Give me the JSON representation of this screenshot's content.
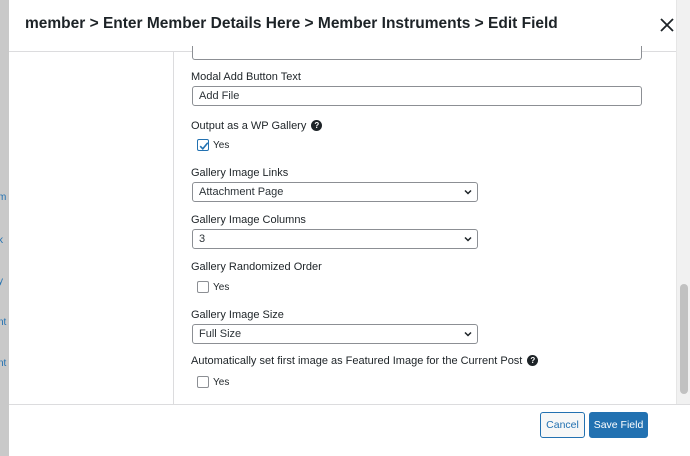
{
  "background": {
    "links": [
      "m",
      "k",
      "y",
      "nt",
      "nt"
    ]
  },
  "modal": {
    "title": "member > Enter Member Details Here > Member Instruments > Edit Field",
    "close_icon": "close-icon"
  },
  "fields": {
    "modal_add_button_text": {
      "label": "Modal Add Button Text",
      "value": "Add File"
    },
    "output_wp_gallery": {
      "label": "Output as a WP Gallery",
      "option": "Yes",
      "checked": true
    },
    "gallery_image_links": {
      "label": "Gallery Image Links",
      "selected": "Attachment Page"
    },
    "gallery_image_columns": {
      "label": "Gallery Image Columns",
      "selected": "3"
    },
    "gallery_randomized_order": {
      "label": "Gallery Randomized Order",
      "option": "Yes",
      "checked": false
    },
    "gallery_image_size": {
      "label": "Gallery Image Size",
      "selected": "Full Size"
    },
    "featured_image": {
      "label": "Automatically set first image as Featured Image for the Current Post",
      "option": "Yes",
      "checked": false
    }
  },
  "footer": {
    "cancel_label": "Cancel",
    "save_label": "Save Field"
  },
  "colors": {
    "accent": "#2271b1",
    "overlay": "#a8a8a8"
  }
}
